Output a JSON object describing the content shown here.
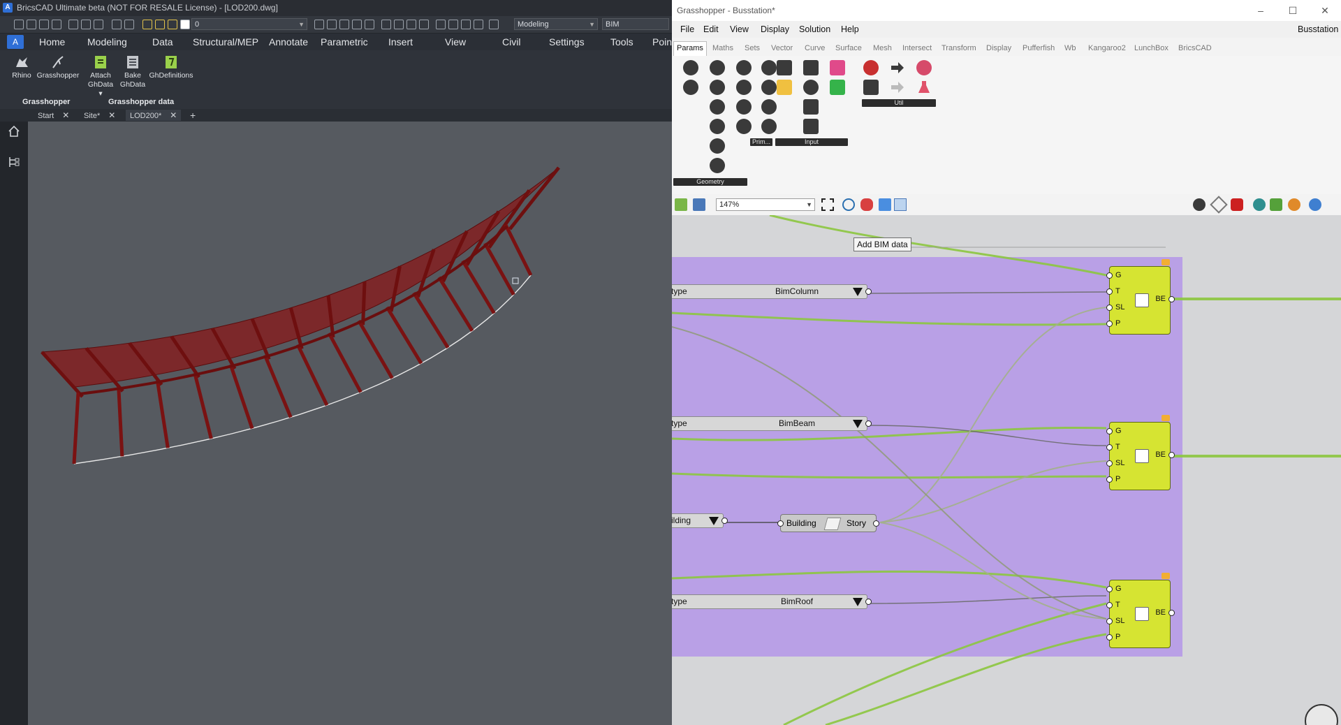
{
  "bricscad": {
    "title": "BricsCAD Ultimate beta (NOT FOR RESALE License) - [LOD200.dwg]",
    "qat": {
      "layer_value": "0",
      "workspace": "Modeling",
      "bim_value": "BIM"
    },
    "ribbon_tabs": [
      "Home",
      "Modeling",
      "Data",
      "Structural/MEP",
      "Annotate",
      "Parametric",
      "Insert",
      "View",
      "Civil",
      "Settings",
      "Tools",
      "Poin"
    ],
    "ribbon": {
      "rhino": "Rhino",
      "grasshopper": "Grasshopper",
      "attach": "Attach",
      "attach_sub": "GhData",
      "bake": "Bake",
      "bake_sub": "GhData",
      "ghdef": "GhDefinitions",
      "group1": "Grasshopper",
      "group2": "Grasshopper data",
      "dots": "...."
    },
    "doc_tabs": [
      "Start",
      "Site*",
      "LOD200*"
    ],
    "colors": {
      "structure": "#8a1818",
      "ribbon_accent": "#2f6fd6"
    }
  },
  "grasshopper": {
    "title": "Grasshopper - Busstation*",
    "doc_label": "Busstation",
    "menu": [
      "File",
      "Edit",
      "View",
      "Display",
      "Solution",
      "Help"
    ],
    "tabs": [
      "Params",
      "Maths",
      "Sets",
      "Vector",
      "Curve",
      "Surface",
      "Mesh",
      "Intersect",
      "Transform",
      "Display",
      "Pufferfish",
      "Wb",
      "Kangaroo2",
      "LunchBox",
      "BricsCAD"
    ],
    "palette_groups": {
      "geometry": "Geometry",
      "primitive": "Prim...",
      "input": "Input",
      "util": "Util"
    },
    "zoom": "147%",
    "tooltip": "Add BIM data",
    "value_lists": [
      {
        "label": "type",
        "value": "BimColumn"
      },
      {
        "label": "type",
        "value": "BimBeam"
      },
      {
        "label": "ilding",
        "value": ""
      },
      {
        "label": "type",
        "value": "BimRoof"
      }
    ],
    "building_story": {
      "left": "Building",
      "right": "Story"
    },
    "component": {
      "inputs": [
        "G",
        "T",
        "SL",
        "P"
      ],
      "output": "BE"
    },
    "colors": {
      "group": "#b9a0e6",
      "component": "#d6e432",
      "wire": "#8cc63f"
    }
  }
}
